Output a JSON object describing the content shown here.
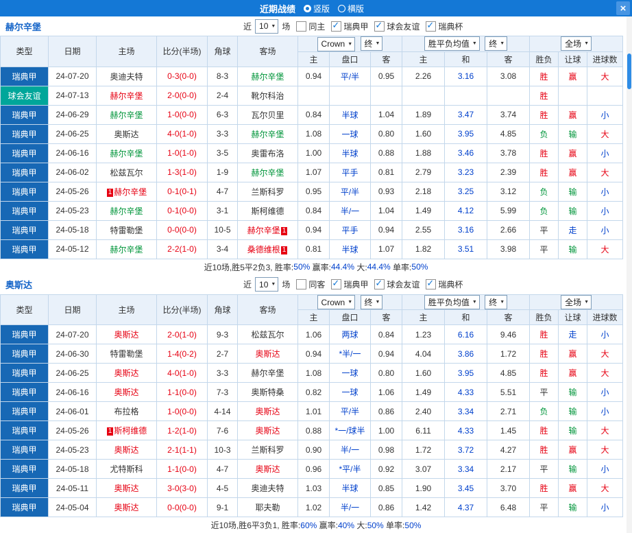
{
  "topbar": {
    "title": "近期战绩",
    "modes": [
      {
        "label": "竖版",
        "selected": true
      },
      {
        "label": "横版",
        "selected": false
      }
    ],
    "close_icon": "×"
  },
  "table_header": {
    "type": "类型",
    "date": "日期",
    "home": "主场",
    "score": "比分(半场)",
    "corner": "角球",
    "away": "客场",
    "bookmaker_select": "Crown",
    "final_select": "终",
    "avg_select": "胜平负均值",
    "final_select2": "终",
    "scope_select": "全场",
    "sub": [
      "主",
      "盘口",
      "客",
      "主",
      "和",
      "客",
      "胜负",
      "让球",
      "进球数"
    ]
  },
  "colors": {
    "topbar_blue": "#1478d6",
    "league_cell_blue": "#1768b5",
    "friendly_cell_teal": "#00a69a",
    "win_red": "#e60012",
    "loss_green": "#00953a",
    "handicap_blue": "#0040cc",
    "team_link_blue": "#1464c8"
  },
  "sections": [
    {
      "team": "赫尔辛堡",
      "filters": {
        "near": "近",
        "count": "10",
        "games": "场",
        "same": "同主",
        "same_checked": false,
        "leagues": [
          {
            "label": "瑞典甲",
            "checked": true
          },
          {
            "label": "球会友谊",
            "checked": true
          },
          {
            "label": "瑞典杯",
            "checked": true
          }
        ]
      },
      "rows": [
        {
          "type": "瑞典甲",
          "type_style": "league",
          "date": "24-07-20",
          "home": {
            "name": "奥迪夫特",
            "c": "dark"
          },
          "score": "0-3(0-0)",
          "corner": "8-3",
          "away": {
            "name": "赫尔辛堡",
            "c": "green"
          },
          "odds": [
            "0.94",
            "平/半",
            "0.95"
          ],
          "europe": [
            "2.26",
            "3.16",
            "3.08"
          ],
          "results": [
            {
              "t": "胜",
              "c": "red"
            },
            {
              "t": "赢",
              "c": "red"
            },
            {
              "t": "大",
              "c": "red"
            }
          ]
        },
        {
          "type": "球会友谊",
          "type_style": "friendly",
          "date": "24-07-13",
          "home": {
            "name": "赫尔辛堡",
            "c": "red"
          },
          "score": "2-0(0-0)",
          "corner": "2-4",
          "away": {
            "name": "靴尔科治",
            "c": "dark"
          },
          "odds": [
            "",
            "",
            ""
          ],
          "europe": [
            "",
            "",
            ""
          ],
          "results": [
            {
              "t": "胜",
              "c": "red"
            },
            {
              "t": "",
              "c": "dark"
            },
            {
              "t": "",
              "c": "dark"
            }
          ]
        },
        {
          "type": "瑞典甲",
          "type_style": "league",
          "date": "24-06-29",
          "home": {
            "name": "赫尔辛堡",
            "c": "green"
          },
          "score": "1-0(0-0)",
          "corner": "6-3",
          "away": {
            "name": "瓦尔贝里",
            "c": "dark"
          },
          "odds": [
            "0.84",
            "半球",
            "1.04"
          ],
          "europe": [
            "1.89",
            "3.47",
            "3.74"
          ],
          "results": [
            {
              "t": "胜",
              "c": "red"
            },
            {
              "t": "赢",
              "c": "red"
            },
            {
              "t": "小",
              "c": "blue"
            }
          ]
        },
        {
          "type": "瑞典甲",
          "type_style": "league",
          "date": "24-06-25",
          "home": {
            "name": "奥斯达",
            "c": "dark"
          },
          "score": "4-0(1-0)",
          "corner": "3-3",
          "away": {
            "name": "赫尔辛堡",
            "c": "green"
          },
          "odds": [
            "1.08",
            "一球",
            "0.80"
          ],
          "europe": [
            "1.60",
            "3.95",
            "4.85"
          ],
          "results": [
            {
              "t": "负",
              "c": "green"
            },
            {
              "t": "输",
              "c": "green"
            },
            {
              "t": "大",
              "c": "red"
            }
          ]
        },
        {
          "type": "瑞典甲",
          "type_style": "league",
          "date": "24-06-16",
          "home": {
            "name": "赫尔辛堡",
            "c": "green"
          },
          "score": "1-0(1-0)",
          "corner": "3-5",
          "away": {
            "name": "奥雷布洛",
            "c": "dark"
          },
          "odds": [
            "1.00",
            "半球",
            "0.88"
          ],
          "europe": [
            "1.88",
            "3.46",
            "3.78"
          ],
          "results": [
            {
              "t": "胜",
              "c": "red"
            },
            {
              "t": "赢",
              "c": "red"
            },
            {
              "t": "小",
              "c": "blue"
            }
          ]
        },
        {
          "type": "瑞典甲",
          "type_style": "league",
          "date": "24-06-02",
          "home": {
            "name": "松兹瓦尔",
            "c": "dark"
          },
          "score": "1-3(1-0)",
          "corner": "1-9",
          "away": {
            "name": "赫尔辛堡",
            "c": "green"
          },
          "odds": [
            "1.07",
            "平手",
            "0.81"
          ],
          "europe": [
            "2.79",
            "3.23",
            "2.39"
          ],
          "results": [
            {
              "t": "胜",
              "c": "red"
            },
            {
              "t": "赢",
              "c": "red"
            },
            {
              "t": "大",
              "c": "red"
            }
          ]
        },
        {
          "type": "瑞典甲",
          "type_style": "league",
          "date": "24-05-26",
          "home": {
            "name": "赫尔辛堡",
            "c": "red",
            "badge": "1",
            "badge_pos": "before"
          },
          "score": "0-1(0-1)",
          "corner": "4-7",
          "away": {
            "name": "兰斯科罗",
            "c": "dark"
          },
          "odds": [
            "0.95",
            "平/半",
            "0.93"
          ],
          "europe": [
            "2.18",
            "3.25",
            "3.12"
          ],
          "results": [
            {
              "t": "负",
              "c": "green"
            },
            {
              "t": "输",
              "c": "green"
            },
            {
              "t": "小",
              "c": "blue"
            }
          ]
        },
        {
          "type": "瑞典甲",
          "type_style": "league",
          "date": "24-05-23",
          "home": {
            "name": "赫尔辛堡",
            "c": "green"
          },
          "score": "0-1(0-0)",
          "corner": "3-1",
          "away": {
            "name": "斯柯维德",
            "c": "dark"
          },
          "odds": [
            "0.84",
            "半/一",
            "1.04"
          ],
          "europe": [
            "1.49",
            "4.12",
            "5.99"
          ],
          "results": [
            {
              "t": "负",
              "c": "green"
            },
            {
              "t": "输",
              "c": "green"
            },
            {
              "t": "小",
              "c": "blue"
            }
          ]
        },
        {
          "type": "瑞典甲",
          "type_style": "league",
          "date": "24-05-18",
          "home": {
            "name": "特雷勒堡",
            "c": "dark"
          },
          "score": "0-0(0-0)",
          "corner": "10-5",
          "away": {
            "name": "赫尔辛堡",
            "c": "red",
            "badge": "1",
            "badge_pos": "after"
          },
          "odds": [
            "0.94",
            "平手",
            "0.94"
          ],
          "europe": [
            "2.55",
            "3.16",
            "2.66"
          ],
          "results": [
            {
              "t": "平",
              "c": "dark"
            },
            {
              "t": "走",
              "c": "blue"
            },
            {
              "t": "小",
              "c": "blue"
            }
          ]
        },
        {
          "type": "瑞典甲",
          "type_style": "league",
          "date": "24-05-12",
          "home": {
            "name": "赫尔辛堡",
            "c": "green"
          },
          "score": "2-2(1-0)",
          "corner": "3-4",
          "away": {
            "name": "桑德维根",
            "c": "red",
            "badge": "1",
            "badge_pos": "after"
          },
          "odds": [
            "0.81",
            "半球",
            "1.07"
          ],
          "europe": [
            "1.82",
            "3.51",
            "3.98"
          ],
          "results": [
            {
              "t": "平",
              "c": "dark"
            },
            {
              "t": "输",
              "c": "green"
            },
            {
              "t": "大",
              "c": "red"
            }
          ]
        }
      ],
      "footer": [
        {
          "t": "近10场,胜5平2负3, 胜率:",
          "c": "dark"
        },
        {
          "t": "50%",
          "c": "blue"
        },
        {
          "t": " 赢率:",
          "c": "dark"
        },
        {
          "t": "44.4%",
          "c": "blue"
        },
        {
          "t": " 大:",
          "c": "dark"
        },
        {
          "t": "44.4%",
          "c": "blue"
        },
        {
          "t": " 单率:",
          "c": "dark"
        },
        {
          "t": "50%",
          "c": "blue"
        }
      ]
    },
    {
      "team": "奥斯达",
      "filters": {
        "near": "近",
        "count": "10",
        "games": "场",
        "same": "同客",
        "same_checked": false,
        "leagues": [
          {
            "label": "瑞典甲",
            "checked": true
          },
          {
            "label": "球会友谊",
            "checked": true
          },
          {
            "label": "瑞典杯",
            "checked": true
          }
        ]
      },
      "rows": [
        {
          "type": "瑞典甲",
          "type_style": "league",
          "date": "24-07-20",
          "home": {
            "name": "奥斯达",
            "c": "red"
          },
          "score": "2-0(1-0)",
          "corner": "9-3",
          "away": {
            "name": "松兹瓦尔",
            "c": "dark"
          },
          "odds": [
            "1.06",
            "两球",
            "0.84"
          ],
          "europe": [
            "1.23",
            "6.16",
            "9.46"
          ],
          "results": [
            {
              "t": "胜",
              "c": "red"
            },
            {
              "t": "走",
              "c": "blue"
            },
            {
              "t": "小",
              "c": "blue"
            }
          ]
        },
        {
          "type": "瑞典甲",
          "type_style": "league",
          "date": "24-06-30",
          "home": {
            "name": "特雷勒堡",
            "c": "dark"
          },
          "score": "1-4(0-2)",
          "corner": "2-7",
          "away": {
            "name": "奥斯达",
            "c": "red"
          },
          "odds": [
            "0.94",
            "*半/一",
            "0.94"
          ],
          "europe": [
            "4.04",
            "3.86",
            "1.72"
          ],
          "results": [
            {
              "t": "胜",
              "c": "red"
            },
            {
              "t": "赢",
              "c": "red"
            },
            {
              "t": "大",
              "c": "red"
            }
          ]
        },
        {
          "type": "瑞典甲",
          "type_style": "league",
          "date": "24-06-25",
          "home": {
            "name": "奥斯达",
            "c": "red"
          },
          "score": "4-0(1-0)",
          "corner": "3-3",
          "away": {
            "name": "赫尔辛堡",
            "c": "dark"
          },
          "odds": [
            "1.08",
            "一球",
            "0.80"
          ],
          "europe": [
            "1.60",
            "3.95",
            "4.85"
          ],
          "results": [
            {
              "t": "胜",
              "c": "red"
            },
            {
              "t": "赢",
              "c": "red"
            },
            {
              "t": "大",
              "c": "red"
            }
          ]
        },
        {
          "type": "瑞典甲",
          "type_style": "league",
          "date": "24-06-16",
          "home": {
            "name": "奥斯达",
            "c": "red"
          },
          "score": "1-1(0-0)",
          "corner": "7-3",
          "away": {
            "name": "奥斯特桑",
            "c": "dark"
          },
          "odds": [
            "0.82",
            "一球",
            "1.06"
          ],
          "europe": [
            "1.49",
            "4.33",
            "5.51"
          ],
          "results": [
            {
              "t": "平",
              "c": "dark"
            },
            {
              "t": "输",
              "c": "green"
            },
            {
              "t": "小",
              "c": "blue"
            }
          ]
        },
        {
          "type": "瑞典甲",
          "type_style": "league",
          "date": "24-06-01",
          "home": {
            "name": "布拉格",
            "c": "dark"
          },
          "score": "1-0(0-0)",
          "corner": "4-14",
          "away": {
            "name": "奥斯达",
            "c": "red"
          },
          "odds": [
            "1.01",
            "平/半",
            "0.86"
          ],
          "europe": [
            "2.40",
            "3.34",
            "2.71"
          ],
          "results": [
            {
              "t": "负",
              "c": "green"
            },
            {
              "t": "输",
              "c": "green"
            },
            {
              "t": "小",
              "c": "blue"
            }
          ]
        },
        {
          "type": "瑞典甲",
          "type_style": "league",
          "date": "24-05-26",
          "home": {
            "name": "斯柯维德",
            "c": "red",
            "badge": "1",
            "badge_pos": "before"
          },
          "score": "1-2(1-0)",
          "corner": "7-6",
          "away": {
            "name": "奥斯达",
            "c": "red"
          },
          "odds": [
            "0.88",
            "*一/球半",
            "1.00"
          ],
          "europe": [
            "6.11",
            "4.33",
            "1.45"
          ],
          "results": [
            {
              "t": "胜",
              "c": "red"
            },
            {
              "t": "输",
              "c": "green"
            },
            {
              "t": "大",
              "c": "red"
            }
          ]
        },
        {
          "type": "瑞典甲",
          "type_style": "league",
          "date": "24-05-23",
          "home": {
            "name": "奥斯达",
            "c": "red"
          },
          "score": "2-1(1-1)",
          "corner": "10-3",
          "away": {
            "name": "兰斯科罗",
            "c": "dark"
          },
          "odds": [
            "0.90",
            "半/一",
            "0.98"
          ],
          "europe": [
            "1.72",
            "3.72",
            "4.27"
          ],
          "results": [
            {
              "t": "胜",
              "c": "red"
            },
            {
              "t": "赢",
              "c": "red"
            },
            {
              "t": "大",
              "c": "red"
            }
          ]
        },
        {
          "type": "瑞典甲",
          "type_style": "league",
          "date": "24-05-18",
          "home": {
            "name": "尤特斯科",
            "c": "dark"
          },
          "score": "1-1(0-0)",
          "corner": "4-7",
          "away": {
            "name": "奥斯达",
            "c": "red"
          },
          "odds": [
            "0.96",
            "*平/半",
            "0.92"
          ],
          "europe": [
            "3.07",
            "3.34",
            "2.17"
          ],
          "results": [
            {
              "t": "平",
              "c": "dark"
            },
            {
              "t": "输",
              "c": "green"
            },
            {
              "t": "小",
              "c": "blue"
            }
          ]
        },
        {
          "type": "瑞典甲",
          "type_style": "league",
          "date": "24-05-11",
          "home": {
            "name": "奥斯达",
            "c": "red"
          },
          "score": "3-0(3-0)",
          "corner": "4-5",
          "away": {
            "name": "奥迪夫特",
            "c": "dark"
          },
          "odds": [
            "1.03",
            "半球",
            "0.85"
          ],
          "europe": [
            "1.90",
            "3.45",
            "3.70"
          ],
          "results": [
            {
              "t": "胜",
              "c": "red"
            },
            {
              "t": "赢",
              "c": "red"
            },
            {
              "t": "大",
              "c": "red"
            }
          ]
        },
        {
          "type": "瑞典甲",
          "type_style": "league",
          "date": "24-05-04",
          "home": {
            "name": "奥斯达",
            "c": "red"
          },
          "score": "0-0(0-0)",
          "corner": "9-1",
          "away": {
            "name": "耶夫勒",
            "c": "dark"
          },
          "odds": [
            "1.02",
            "半/一",
            "0.86"
          ],
          "europe": [
            "1.42",
            "4.37",
            "6.48"
          ],
          "results": [
            {
              "t": "平",
              "c": "dark"
            },
            {
              "t": "输",
              "c": "green"
            },
            {
              "t": "小",
              "c": "blue"
            }
          ]
        }
      ],
      "footer": [
        {
          "t": "近10场,胜6平3负1, 胜率:",
          "c": "dark"
        },
        {
          "t": "60%",
          "c": "blue"
        },
        {
          "t": " 赢率:",
          "c": "dark"
        },
        {
          "t": "40%",
          "c": "blue"
        },
        {
          "t": " 大:",
          "c": "dark"
        },
        {
          "t": "50%",
          "c": "blue"
        },
        {
          "t": " 单率:",
          "c": "dark"
        },
        {
          "t": "50%",
          "c": "blue"
        }
      ]
    }
  ]
}
